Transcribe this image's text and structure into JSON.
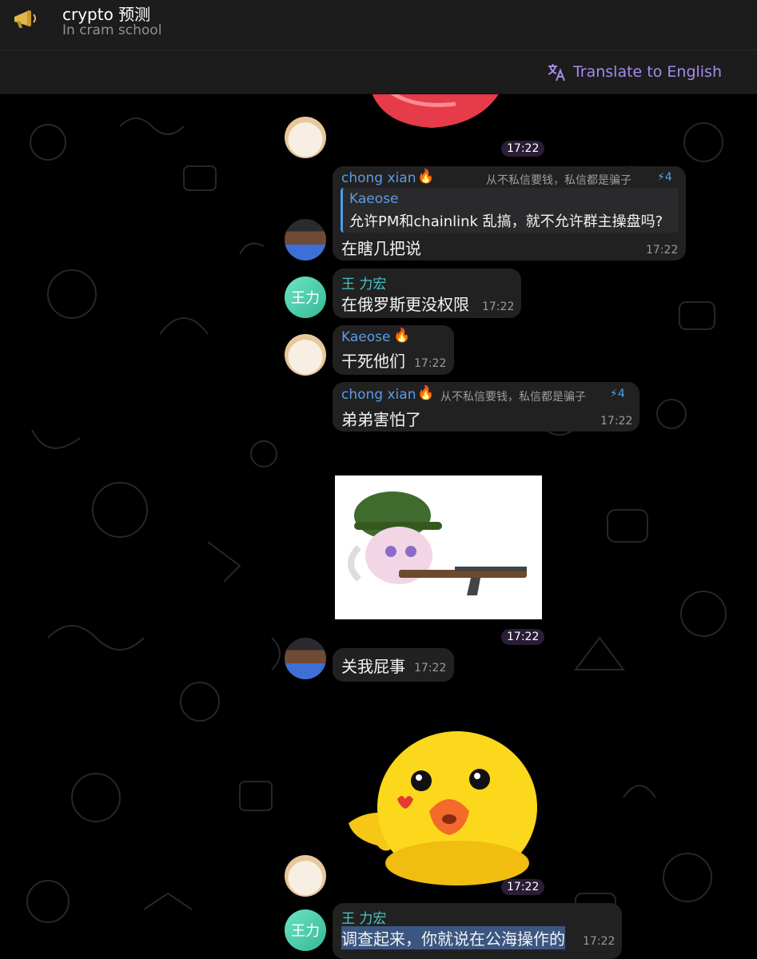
{
  "header": {
    "title": "crypto 预测",
    "subtitle": "In cram school"
  },
  "translate": {
    "label": "Translate to English"
  },
  "colors": {
    "accent": "#a48ce8",
    "name_blue": "#5b9be5",
    "name_teal": "#4fc3c3",
    "bubble": "#212121"
  },
  "messages": [
    {
      "time": "17:22"
    },
    {
      "sender": "chong xian",
      "rank": "从不私信要钱，私信都是骗子",
      "boost": "4",
      "reply_name": "Kaeose",
      "reply_text": "允许PM和chainlink 乱搞，就不允许群主操盘吗?",
      "text": "在瞎几把说",
      "time": "17:22"
    },
    {
      "sender": "王 力宏",
      "avatar_text": "王力",
      "text": "在俄罗斯更没权限",
      "time": "17:22"
    },
    {
      "sender": "Kaeose",
      "text": "干死他们",
      "time": "17:22"
    },
    {
      "sender": "chong xian",
      "rank": "从不私信要钱，私信都是骗子",
      "boost": "4",
      "text": "弟弟害怕了",
      "time": "17:22"
    },
    {
      "time": "17:22"
    },
    {
      "text": "关我屁事",
      "time": "17:22"
    },
    {
      "time": "17:22"
    },
    {
      "sender": "王 力宏",
      "avatar_text": "王力",
      "text": "调查起来，你就说在公海操作的",
      "time": "17:22"
    }
  ]
}
